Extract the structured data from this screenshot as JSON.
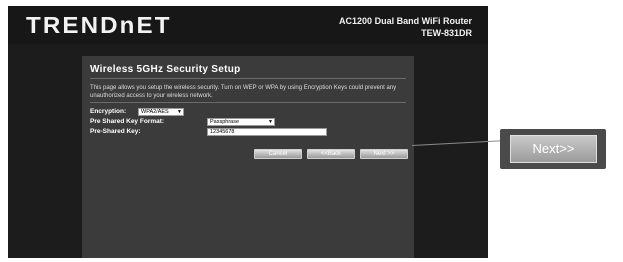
{
  "header": {
    "logo": "TRENDnET",
    "model_line1": "AC1200 Dual Band WiFi Router",
    "model_line2": "TEW-831DR"
  },
  "panel": {
    "title": "Wireless 5GHz Security Setup",
    "description": "This page allows you setup the wireless security. Turn on WEP or WPA by using Encryption Keys could prevent any unauthorized access to your wireless network."
  },
  "form": {
    "encryption": {
      "label": "Encryption:",
      "value": "WPA2/AES"
    },
    "key_format": {
      "label": "Pre Shared Key Format:",
      "value": "Passphrase"
    },
    "psk": {
      "label": "Pre-Shared Key:",
      "value": "12345678"
    }
  },
  "buttons": {
    "cancel": "Cancel",
    "back": "<<Back",
    "next": "Next >>"
  },
  "callout": {
    "label": "Next>>"
  }
}
